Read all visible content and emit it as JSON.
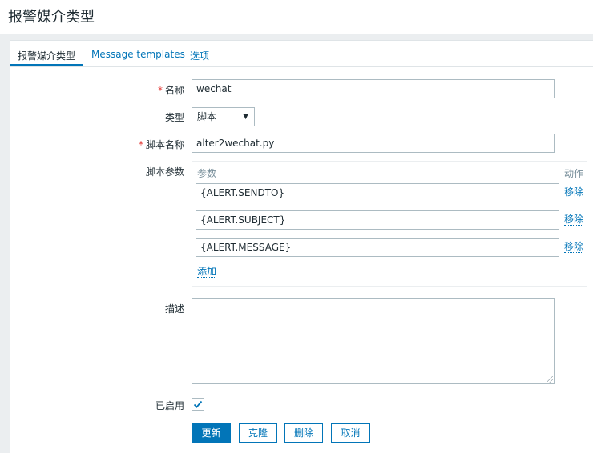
{
  "page": {
    "title": "报警媒介类型"
  },
  "tabs": [
    {
      "label": "报警媒介类型",
      "active": true
    },
    {
      "label": "Message templates",
      "active": false
    },
    {
      "label": "选项",
      "active": false
    }
  ],
  "form": {
    "name_label": "名称",
    "name_value": "wechat",
    "type_label": "类型",
    "type_value": "脚本",
    "script_name_label": "脚本名称",
    "script_name_value": "alter2wechat.py",
    "script_params_label": "脚本参数",
    "params_header": "参数",
    "action_header": "动作",
    "params": [
      {
        "value": "{ALERT.SENDTO}",
        "remove_label": "移除"
      },
      {
        "value": "{ALERT.SUBJECT}",
        "remove_label": "移除"
      },
      {
        "value": "{ALERT.MESSAGE}",
        "remove_label": "移除"
      }
    ],
    "add_label": "添加",
    "description_label": "描述",
    "description_value": "",
    "enabled_label": "已启用",
    "enabled": true,
    "required_mark": "*"
  },
  "buttons": {
    "update": "更新",
    "clone": "克隆",
    "delete": "删除",
    "cancel": "取消"
  },
  "colors": {
    "accent": "#0275b8",
    "required": "#e33734",
    "border": "#acbbc2"
  },
  "icons": {
    "dropdown": "chevron-down-icon",
    "check": "check-icon"
  }
}
